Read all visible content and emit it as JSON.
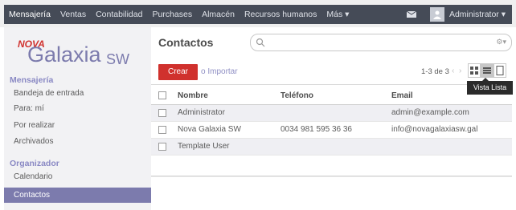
{
  "topbar": {
    "menu": [
      "Mensajería",
      "Ventas",
      "Contabilidad",
      "Purchases",
      "Almacén",
      "Recursos humanos",
      "Más ▾"
    ],
    "active_index": 0,
    "user": "Administrator ▾",
    "bg_color": "#454b57"
  },
  "sidebar": {
    "logo": {
      "top_text": "NOVA",
      "main_text": "Galaxia",
      "suffix": "SW"
    },
    "section1_title": "Mensajería",
    "section1_items": [
      "Bandeja de entrada",
      "Para: mí",
      "Por realizar",
      "Archivados"
    ],
    "section2_title": "Organizador",
    "section2_items": [
      "Calendario",
      "Contactos"
    ],
    "active_item": "Contactos",
    "accent_color": "#7c7bad"
  },
  "main": {
    "title": "Contactos",
    "create_label": "Crear",
    "import_label": "o Importar",
    "pager_text": "1-3 de 3",
    "tooltip": "Vista Lista",
    "search_placeholder": "",
    "columns": [
      "Nombre",
      "Teléfono",
      "Email"
    ],
    "rows": [
      {
        "name": "Administrator",
        "phone": "",
        "email": "admin@example.com"
      },
      {
        "name": "Nova Galaxia SW",
        "phone": "0034 981 595 36 36",
        "email": "info@novagalaxiasw.gal"
      },
      {
        "name": "Template User",
        "phone": "",
        "email": ""
      }
    ],
    "create_color": "#d0312d"
  }
}
